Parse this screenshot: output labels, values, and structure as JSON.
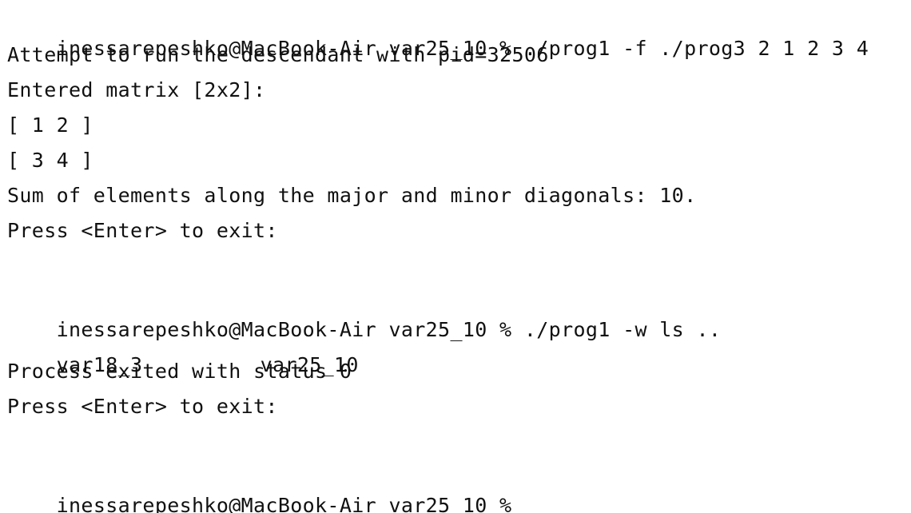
{
  "terminal": {
    "prompt": "inessarepeshko@MacBook-Air var25_10 % ",
    "cmd1": "./prog1 -f ./prog3 2 1 2 3 4",
    "out1": [
      "Attempt to run the descendant with pid=32506",
      "Entered matrix [2x2]:",
      "[ 1 2 ]",
      "[ 3 4 ]",
      "Sum of elements along the major and minor diagonals: 10.",
      "Press <Enter> to exit:"
    ],
    "cmd2": "./prog1 -w ls ..",
    "ls_entries": [
      "var18_3",
      "var25_10"
    ],
    "out2": [
      "Process exited with status 0",
      "Press <Enter> to exit:"
    ]
  }
}
